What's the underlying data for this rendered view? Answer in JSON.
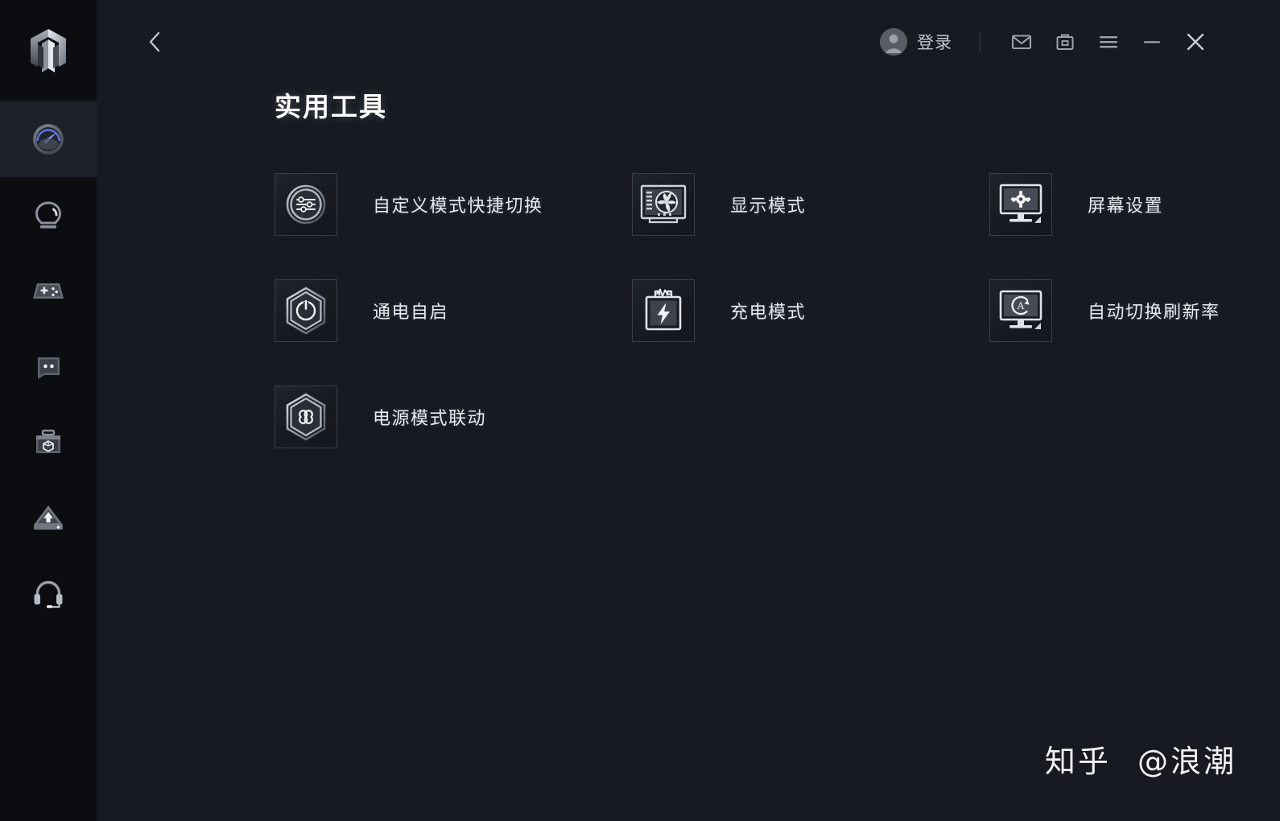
{
  "window": {
    "background_color": "#171a21",
    "sidebar_color": "#0b0d10",
    "accent_color": "#5b73c4"
  },
  "sidebar": {
    "logo": {
      "name": "legion-logo-icon"
    },
    "items": [
      {
        "id": "dashboard",
        "icon": "gauge-icon",
        "active": true
      },
      {
        "id": "lighting",
        "icon": "lightbulb-icon",
        "active": false
      },
      {
        "id": "games",
        "icon": "gamepad-icon",
        "active": false
      },
      {
        "id": "community",
        "icon": "chat-bubble-icon",
        "active": false
      },
      {
        "id": "store",
        "icon": "toolbox-icon",
        "active": false
      },
      {
        "id": "upgrade",
        "icon": "upload-drive-icon",
        "active": false
      },
      {
        "id": "support",
        "icon": "headset-icon",
        "active": false
      }
    ]
  },
  "header": {
    "back_label": "‹",
    "account": {
      "label": "登录",
      "avatar": "user-avatar-icon"
    },
    "buttons": [
      {
        "id": "mail",
        "icon": "mail-icon"
      },
      {
        "id": "toolbox",
        "icon": "briefcase-icon"
      },
      {
        "id": "menu",
        "icon": "hamburger-menu-icon"
      },
      {
        "id": "minimize",
        "icon": "minimize-icon"
      },
      {
        "id": "close",
        "icon": "close-icon"
      }
    ]
  },
  "main": {
    "title": "实用工具",
    "tiles": [
      {
        "id": "custom-mode-switch",
        "label": "自定义模式快捷切换",
        "icon": "sliders-circle-icon"
      },
      {
        "id": "display-mode",
        "label": "显示模式",
        "icon": "gpu-fan-icon"
      },
      {
        "id": "screen-settings",
        "label": "屏幕设置",
        "icon": "monitor-gear-icon"
      },
      {
        "id": "power-on-auto-start",
        "label": "通电自启",
        "icon": "hex-power-icon"
      },
      {
        "id": "charging-mode",
        "label": "充电模式",
        "icon": "battery-bolt-icon"
      },
      {
        "id": "auto-refresh-rate",
        "label": "自动切换刷新率",
        "icon": "monitor-auto-icon"
      },
      {
        "id": "power-mode-link",
        "label": "电源模式联动",
        "icon": "hex-infinity-icon"
      }
    ]
  },
  "watermark": {
    "site": "知乎",
    "handle": "@浪潮"
  }
}
